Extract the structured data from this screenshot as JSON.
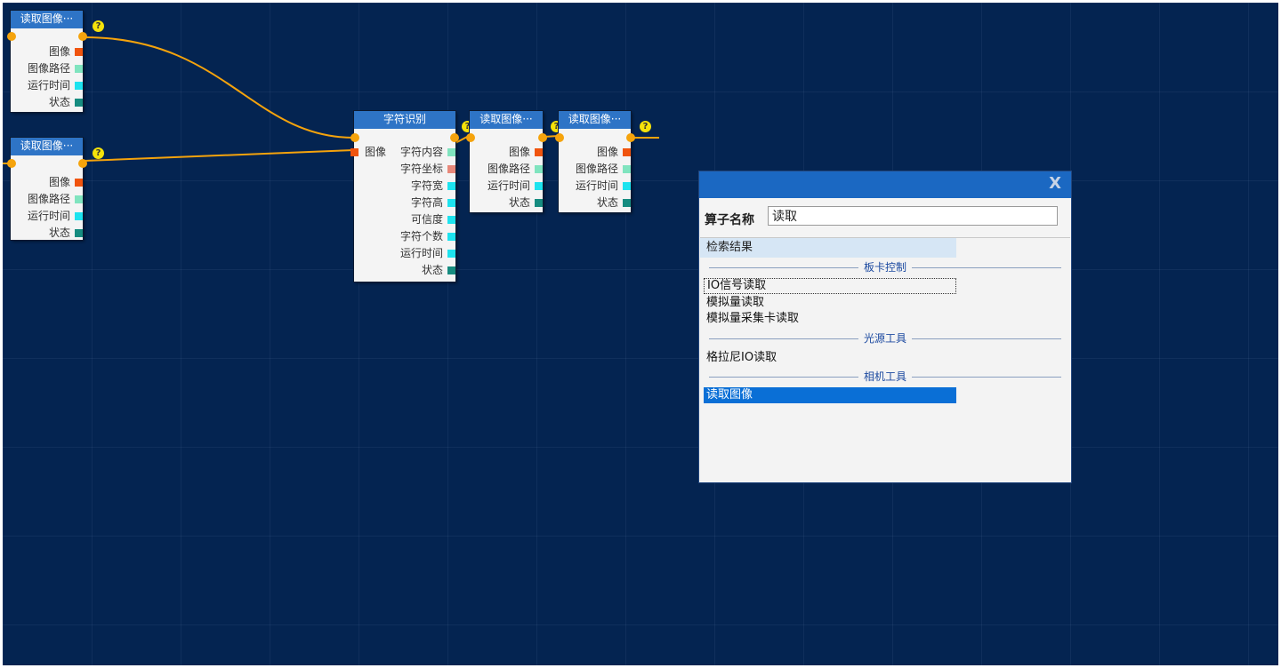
{
  "colors": {
    "canvas_bg": "#042451",
    "node_title_bg": "#2e74c6",
    "wire": "#f5a30c",
    "port_image": "#f0540e",
    "port_path": "#80e4bf",
    "port_time": "#1de3ef",
    "port_status": "#168c80",
    "port_coord": "#e8887a",
    "dialog_header": "#1b68c2",
    "selected_item": "#0a6fd6"
  },
  "nodes": [
    {
      "id": "read1",
      "title": "读取图像···",
      "outputs": [
        {
          "label": "图像",
          "color": "#f0540e"
        },
        {
          "label": "图像路径",
          "color": "#80e4bf"
        },
        {
          "label": "运行时间",
          "color": "#1de3ef"
        },
        {
          "label": "状态",
          "color": "#168c80"
        }
      ]
    },
    {
      "id": "read2",
      "title": "读取图像···",
      "outputs": [
        {
          "label": "图像",
          "color": "#f0540e"
        },
        {
          "label": "图像路径",
          "color": "#80e4bf"
        },
        {
          "label": "运行时间",
          "color": "#1de3ef"
        },
        {
          "label": "状态",
          "color": "#168c80"
        }
      ]
    },
    {
      "id": "ocr",
      "title": "字符识别",
      "input": {
        "label": "图像",
        "color": "#f0540e"
      },
      "outputs": [
        {
          "label": "字符内容",
          "color": "#80e4bf"
        },
        {
          "label": "字符坐标",
          "color": "#e8887a"
        },
        {
          "label": "字符宽",
          "color": "#1de3ef"
        },
        {
          "label": "字符高",
          "color": "#1de3ef"
        },
        {
          "label": "可信度",
          "color": "#1de3ef"
        },
        {
          "label": "字符个数",
          "color": "#1de3ef"
        },
        {
          "label": "运行时间",
          "color": "#1de3ef"
        },
        {
          "label": "状态",
          "color": "#168c80"
        }
      ]
    },
    {
      "id": "read3",
      "title": "读取图像···",
      "outputs": [
        {
          "label": "图像",
          "color": "#f0540e"
        },
        {
          "label": "图像路径",
          "color": "#80e4bf"
        },
        {
          "label": "运行时间",
          "color": "#1de3ef"
        },
        {
          "label": "状态",
          "color": "#168c80"
        }
      ]
    },
    {
      "id": "read4",
      "title": "读取图像···",
      "outputs": [
        {
          "label": "图像",
          "color": "#f0540e"
        },
        {
          "label": "图像路径",
          "color": "#80e4bf"
        },
        {
          "label": "运行时间",
          "color": "#1de3ef"
        },
        {
          "label": "状态",
          "color": "#168c80"
        }
      ]
    }
  ],
  "help_glyph": "?",
  "dialog": {
    "close_label": "X",
    "name_label": "算子名称",
    "name_value": "读取",
    "results_header": "检索结果",
    "groups": [
      {
        "title": "板卡控制",
        "items": [
          "IO信号读取",
          "模拟量读取",
          "模拟量采集卡读取"
        ]
      },
      {
        "title": "光源工具",
        "items": [
          "格拉尼IO读取"
        ]
      },
      {
        "title": "相机工具",
        "items": [
          "读取图像"
        ]
      }
    ],
    "focused_item": "IO信号读取",
    "selected_item": "读取图像"
  }
}
